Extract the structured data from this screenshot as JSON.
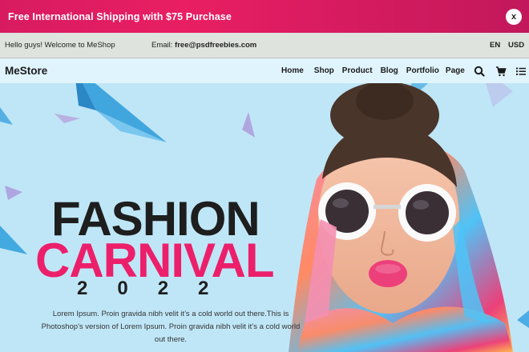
{
  "promo": {
    "text": "Free International Shipping with $75 Purchase",
    "close_label": "x"
  },
  "infobar": {
    "welcome": "Hello guys! Welcome to MeShop",
    "email_label": "Email:",
    "email_value": "free@psdfreebies.com",
    "language": "EN",
    "currency": "USD"
  },
  "navbar": {
    "logo": "MeStore",
    "items": [
      "Home",
      "Shop",
      "Product",
      "Blog",
      "Portfolio",
      "Page"
    ],
    "icons": [
      "search-icon",
      "cart-icon",
      "menu-list-icon"
    ]
  },
  "hero": {
    "title_line1": "FASHION",
    "title_line2": "CARNIVAL",
    "year": "2022",
    "description": "Lorem Ipsum. Proin gravida nibh velit it’s a cold world out there.This is Photoshop's version of Lorem Ipsum. Proin gravida nibh velit it’s a cold world out there."
  },
  "colors": {
    "promo_bg": "#e91e63",
    "accent_pink": "#ec1f6b",
    "hero_bg": "#bfe6f7",
    "title_dark": "#1e1e1e"
  }
}
